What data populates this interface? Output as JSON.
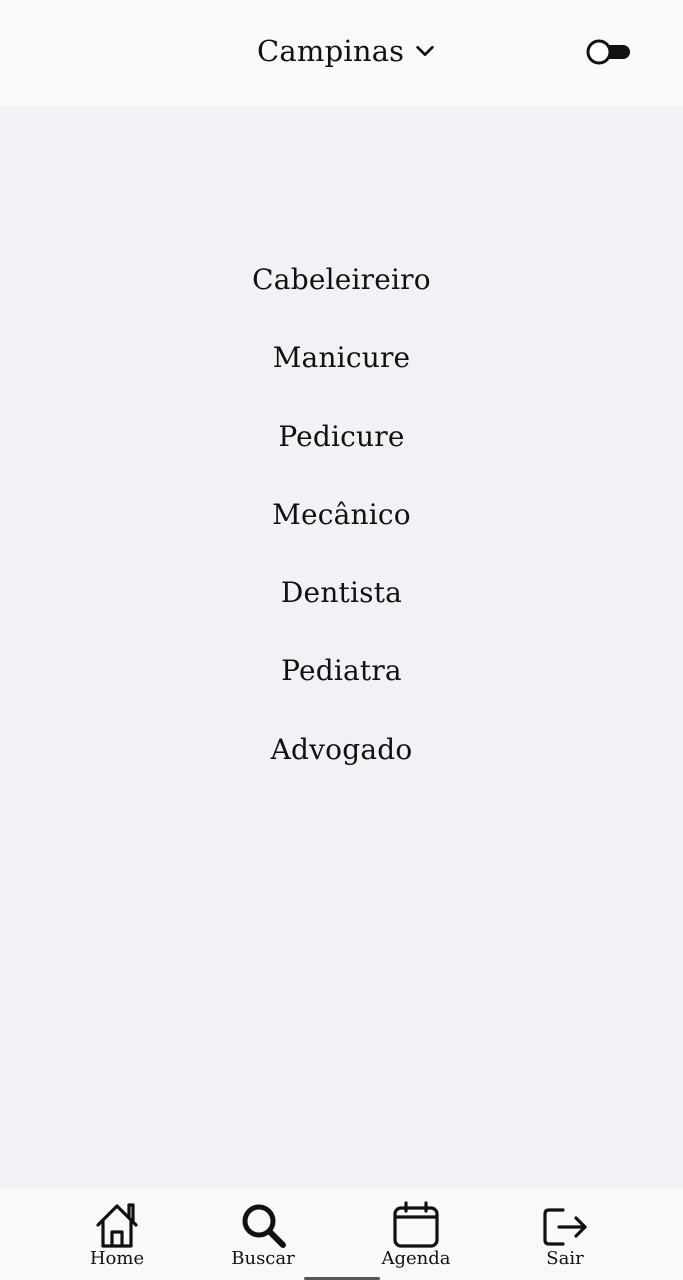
{
  "header": {
    "city": "Campinas",
    "city_icon": "chevron-down-icon",
    "theme_toggle_icon": "toggle-off-icon"
  },
  "services": [
    {
      "label": "Cabeleireiro"
    },
    {
      "label": "Manicure"
    },
    {
      "label": "Pedicure"
    },
    {
      "label": "Mecânico"
    },
    {
      "label": "Dentista"
    },
    {
      "label": "Pediatra"
    },
    {
      "label": "Advogado"
    }
  ],
  "bottom_nav": {
    "items": [
      {
        "label": "Home",
        "icon": "home-icon"
      },
      {
        "label": "Buscar",
        "icon": "search-icon"
      },
      {
        "label": "Agenda",
        "icon": "calendar-icon"
      },
      {
        "label": "Sair",
        "icon": "logout-icon"
      }
    ]
  },
  "colors": {
    "background": "#f1f2f6",
    "bars": "#f8f9fb",
    "text": "#111111"
  }
}
